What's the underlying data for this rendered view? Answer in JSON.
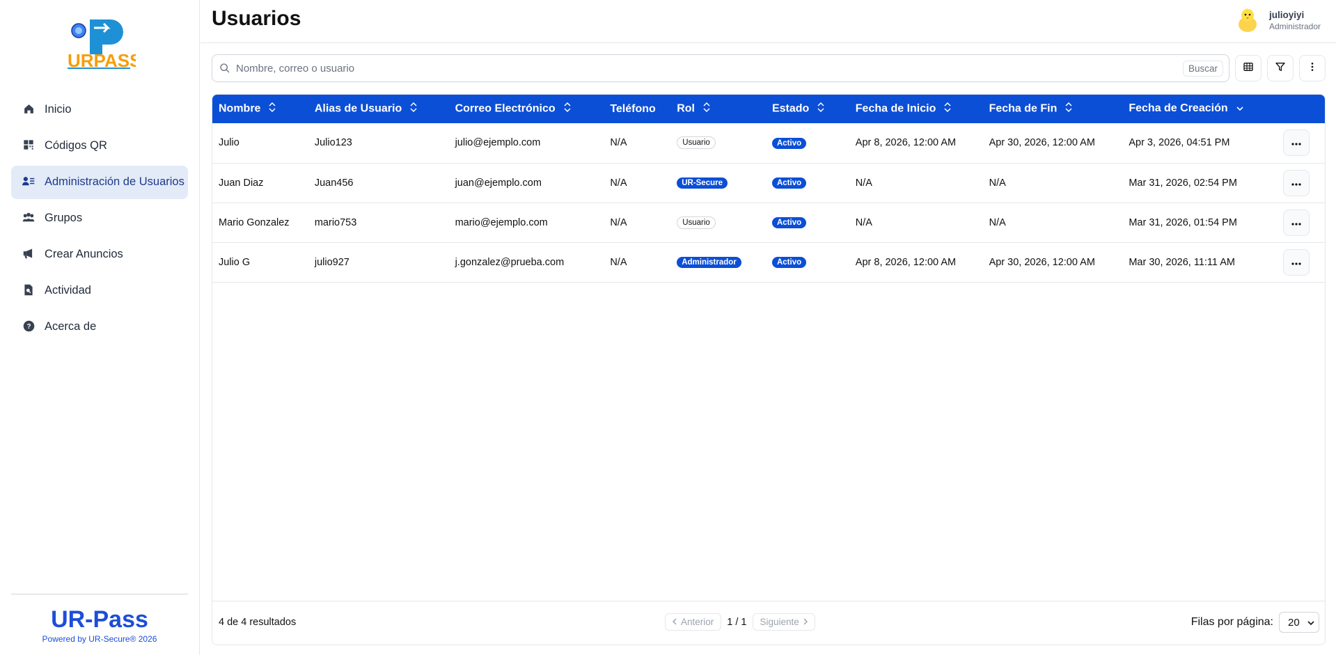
{
  "sidebar": {
    "logo_text": "URPASS",
    "items": [
      {
        "label": "Inicio",
        "icon": "home-icon"
      },
      {
        "label": "Códigos QR",
        "icon": "qr-code-icon"
      },
      {
        "label": "Administración de Usuarios",
        "icon": "user-admin-icon",
        "active": true
      },
      {
        "label": "Grupos",
        "icon": "group-icon"
      },
      {
        "label": "Crear Anuncios",
        "icon": "megaphone-icon"
      },
      {
        "label": "Actividad",
        "icon": "activity-icon"
      },
      {
        "label": "Acerca de",
        "icon": "help-icon"
      }
    ],
    "brand": "UR-Pass",
    "powered": "Powered by UR-Secure® 2026"
  },
  "header": {
    "title": "Usuarios",
    "user_name": "julioyiyi",
    "user_role": "Administrador"
  },
  "search": {
    "placeholder": "Nombre, correo o usuario",
    "button": "Buscar"
  },
  "table": {
    "columns": [
      "Nombre",
      "Alias de Usuario",
      "Correo Electrónico",
      "Teléfono",
      "Rol",
      "Estado",
      "Fecha de Inicio",
      "Fecha de Fin",
      "Fecha de Creación"
    ],
    "rows": [
      {
        "nombre": "Julio",
        "alias": "Julio123",
        "correo": "julio@ejemplo.com",
        "telefono": "N/A",
        "rol": "Usuario",
        "estado": "Activo",
        "inicio": "Apr 8, 2026, 12:00 AM",
        "fin": "Apr 30, 2026, 12:00 AM",
        "creacion": "Apr 3, 2026, 04:51 PM"
      },
      {
        "nombre": "Juan Diaz",
        "alias": "Juan456",
        "correo": "juan@ejemplo.com",
        "telefono": "N/A",
        "rol": "UR-Secure",
        "estado": "Activo",
        "inicio": "N/A",
        "fin": "N/A",
        "creacion": "Mar 31, 2026, 02:54 PM"
      },
      {
        "nombre": "Mario Gonzalez",
        "alias": "mario753",
        "correo": "mario@ejemplo.com",
        "telefono": "N/A",
        "rol": "Usuario",
        "estado": "Activo",
        "inicio": "N/A",
        "fin": "N/A",
        "creacion": "Mar 31, 2026, 01:54 PM"
      },
      {
        "nombre": "Julio G",
        "alias": "julio927",
        "correo": "j.gonzalez@prueba.com",
        "telefono": "N/A",
        "rol": "Administrador",
        "estado": "Activo",
        "inicio": "Apr 8, 2026, 12:00 AM",
        "fin": "Apr 30, 2026, 12:00 AM",
        "creacion": "Mar 30, 2026, 11:11 AM"
      }
    ],
    "results": "4 de 4 resultados",
    "prev": "Anterior",
    "page_info": "1 / 1",
    "next": "Siguiente",
    "rows_per_page_label": "Filas por página:",
    "rows_per_page": "20"
  },
  "colors": {
    "accent": "#0b4fd6",
    "active_nav_bg": "#e3ebf8"
  }
}
